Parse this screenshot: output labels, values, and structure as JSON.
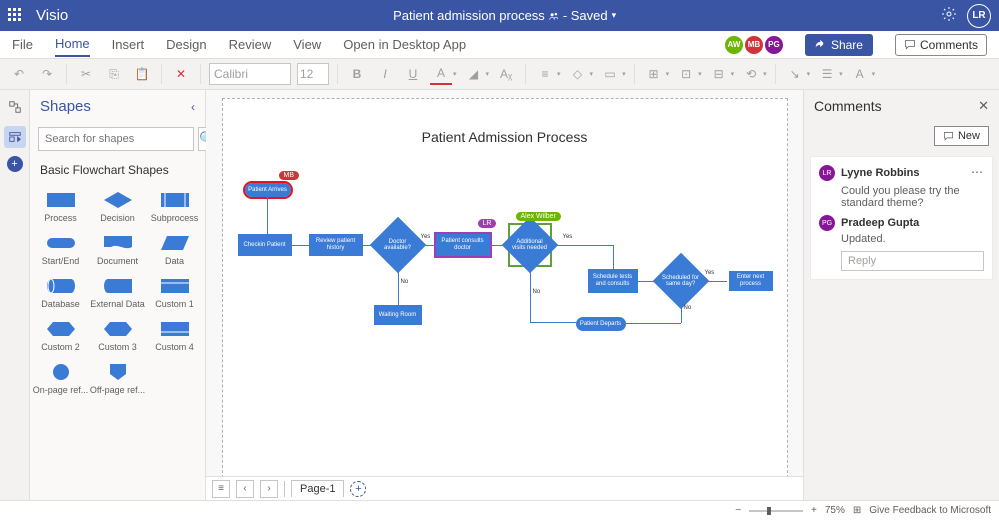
{
  "app_name": "Visio",
  "document": {
    "title": "Patient admission process",
    "state": "Saved"
  },
  "current_user": {
    "initials": "LR"
  },
  "tabs": [
    "File",
    "Home",
    "Insert",
    "Design",
    "Review",
    "View"
  ],
  "active_tab": "Home",
  "open_desktop": "Open in Desktop App",
  "presence": [
    {
      "initials": "AW",
      "color": "#6bb700"
    },
    {
      "initials": "MB",
      "color": "#d13438"
    },
    {
      "initials": "PG",
      "color": "#881798"
    }
  ],
  "share_label": "Share",
  "comments_btn_label": "Comments",
  "font": {
    "name": "Calibri",
    "size": "12"
  },
  "shapes_panel": {
    "title": "Shapes",
    "search_placeholder": "Search for shapes",
    "stencil": "Basic Flowchart Shapes",
    "items": [
      "Process",
      "Decision",
      "Subprocess",
      "Start/End",
      "Document",
      "Data",
      "Database",
      "External Data",
      "Custom 1",
      "Custom 2",
      "Custom 3",
      "Custom 4",
      "On-page ref...",
      "Off-page ref..."
    ]
  },
  "canvas": {
    "title": "Patient Admission Process",
    "shapes": {
      "s1": "Patient Arrives",
      "s2": "Checkin Patient",
      "s3": "Review patient history",
      "s4": "Doctor available?",
      "s5": "Patient consults doctor",
      "s6": "Additional visits needed",
      "s7": "Waiting Room",
      "s8": "Schedule tests and consults",
      "s9": "Scheduled for same day?",
      "s10": "Enter next process",
      "s11": "Patient Departs"
    },
    "labels": {
      "yes": "Yes",
      "no": "No"
    },
    "badges": {
      "mb": "MB",
      "lr": "LR",
      "aw": "Alex Wilber"
    }
  },
  "page_tabs": {
    "page1": "Page-1"
  },
  "comments": {
    "title": "Comments",
    "new_label": "New",
    "thread": {
      "author": "Lyyne Robbins",
      "av": "LR",
      "av_color": "#881798",
      "text": "Could you please try the standard theme?",
      "reply_author": "Pradeep Gupta",
      "reply_av": "PG",
      "reply_av_color": "#881798",
      "reply_text": "Updated.",
      "reply_placeholder": "Reply"
    }
  },
  "status": {
    "zoom_pct": "75%",
    "feedback": "Give Feedback to Microsoft"
  }
}
